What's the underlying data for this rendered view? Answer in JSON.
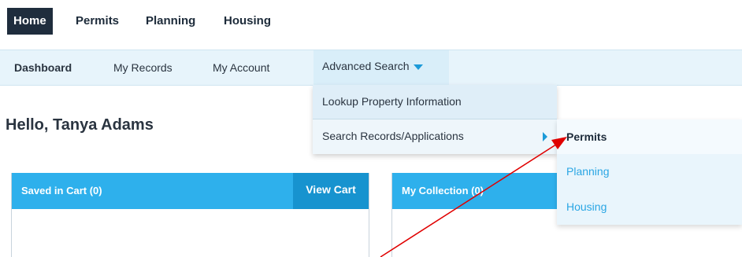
{
  "top_nav": {
    "tabs": [
      {
        "label": "Home",
        "active": true
      },
      {
        "label": "Permits",
        "active": false
      },
      {
        "label": "Planning",
        "active": false
      },
      {
        "label": "Housing",
        "active": false
      }
    ]
  },
  "sub_nav": {
    "tabs": [
      {
        "label": "Dashboard",
        "active": true
      },
      {
        "label": "My Records",
        "active": false
      },
      {
        "label": "My Account",
        "active": false
      }
    ],
    "advanced_search_label": "Advanced Search"
  },
  "dropdown": {
    "items": [
      {
        "label": "Lookup Property Information"
      },
      {
        "label": "Search Records/Applications"
      }
    ]
  },
  "submenu": {
    "items": [
      {
        "label": "Permits",
        "active": true
      },
      {
        "label": "Planning",
        "active": false
      },
      {
        "label": "Housing",
        "active": false
      }
    ]
  },
  "greeting": "Hello, Tanya Adams",
  "cart_panel": {
    "title": "Saved in Cart (0)",
    "button_label": "View Cart"
  },
  "collection_panel": {
    "title": "My Collection (0)"
  },
  "colors": {
    "nav_dark": "#1f2d3d",
    "accent_blue": "#2eb0ec",
    "accent_blue_dark": "#1793cf",
    "annotation_red": "#e00000"
  }
}
